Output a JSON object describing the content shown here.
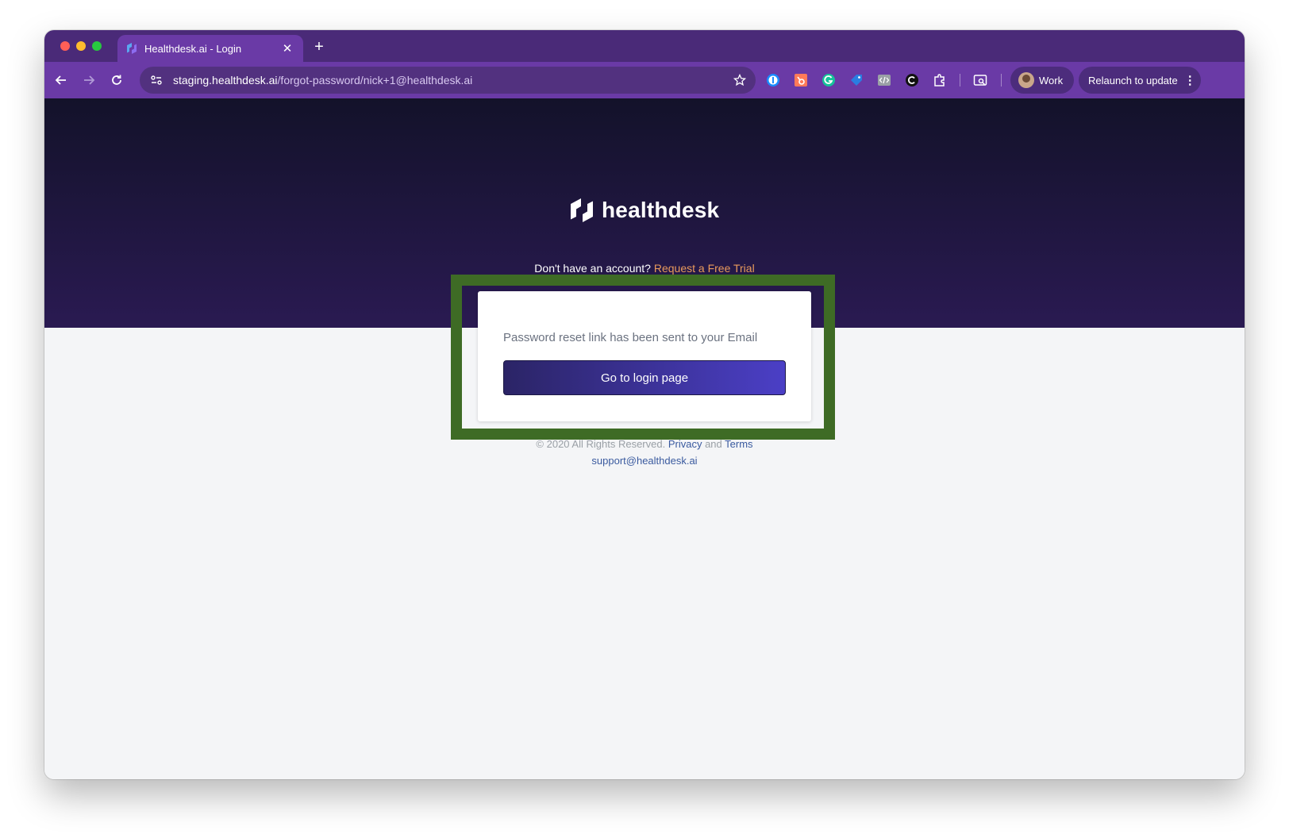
{
  "browser": {
    "tab": {
      "title": "Healthdesk.ai - Login",
      "close_glyph": "✕"
    },
    "new_tab_glyph": "+",
    "url_host": "staging.healthdesk.ai",
    "url_path": "/forgot-password/nick+1@healthdesk.ai",
    "profile": {
      "name": "Work"
    },
    "relaunch": {
      "label": "Relaunch to update",
      "menu_glyph": "⋮"
    },
    "extensions": [
      "onepassword-icon",
      "hubspot-icon",
      "grammarly-icon",
      "tag-icon",
      "code-icon",
      "extension-c-icon",
      "puzzle-icon",
      "tab-search-icon"
    ]
  },
  "page": {
    "logo_text": "healthdesk",
    "signup_prompt": "Don't have an account?",
    "signup_link": "Request a Free Trial",
    "message": "Password reset link has been sent to your Email",
    "login_button": "Go to login page",
    "footer": {
      "copyright": "© 2020 All Rights Reserved.",
      "privacy": "Privacy",
      "and": "and",
      "terms": "Terms",
      "support_email": "support@healthdesk.ai"
    }
  },
  "colors": {
    "tab_strip": "#4a2a78",
    "toolbar": "#6a3aa6",
    "hero_top": "#13122a",
    "hero_bottom": "#2a1a52",
    "highlight_border": "#3e6b25",
    "button_start": "#2b2466",
    "button_end": "#4b3fc6",
    "trial_link": "#e99a5c"
  }
}
